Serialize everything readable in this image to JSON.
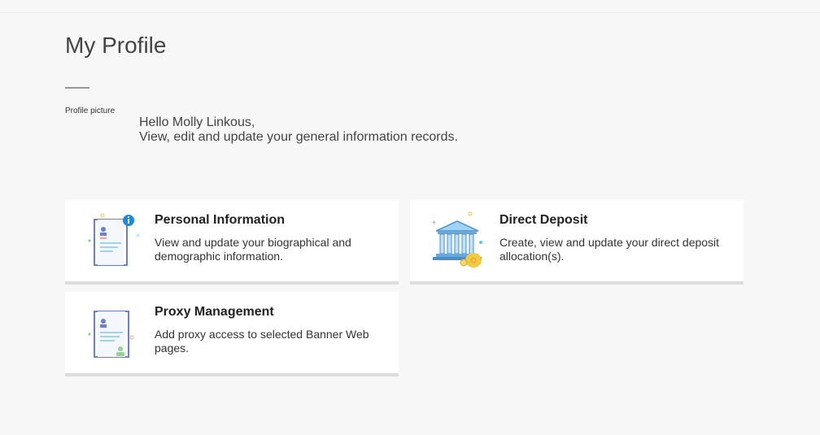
{
  "page": {
    "title": "My Profile",
    "profile_picture_label": "Profile picture",
    "greeting_line1": "Hello Molly Linkous,",
    "greeting_line2": "View, edit and update your general information records."
  },
  "cards": [
    {
      "title": "Personal Information",
      "description": "View and update your biographical and demographic information.",
      "icon": "personal-information-icon"
    },
    {
      "title": "Direct Deposit",
      "description": "Create, view and update your direct deposit allocation(s).",
      "icon": "bank-icon"
    },
    {
      "title": "Proxy Management",
      "description": "Add proxy access to selected Banner Web pages.",
      "icon": "proxy-document-icon"
    }
  ],
  "colors": {
    "accent_blue": "#1e88e5",
    "icon_outline": "#6c7fd8",
    "icon_light_blue": "#9fd3f5",
    "icon_gold": "#f5c842"
  }
}
